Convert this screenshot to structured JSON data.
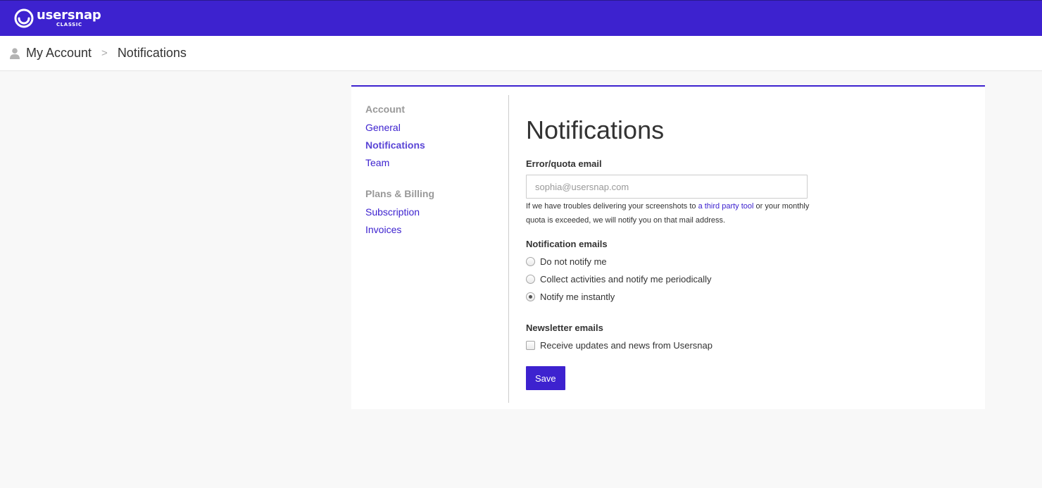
{
  "brand": {
    "name": "usersnap",
    "edition": "CLASSIC",
    "color": "#3d22cf"
  },
  "breadcrumb": {
    "icon": "user-icon",
    "account": "My Account",
    "separator": ">",
    "current": "Notifications"
  },
  "sidebar": {
    "groups": [
      {
        "title": "Account",
        "items": [
          {
            "label": "General",
            "active": false
          },
          {
            "label": "Notifications",
            "active": true
          },
          {
            "label": "Team",
            "active": false
          }
        ]
      },
      {
        "title": "Plans & Billing",
        "items": [
          {
            "label": "Subscription",
            "active": false
          },
          {
            "label": "Invoices",
            "active": false
          }
        ]
      }
    ]
  },
  "main": {
    "title": "Notifications",
    "error_email": {
      "label": "Error/quota email",
      "value": "",
      "placeholder": "sophia@usersnap.com",
      "help_before": "If we have troubles delivering your screenshots to ",
      "help_link": "a third party tool",
      "help_after": " or your monthly quota is exceeded, we will notify you on that mail address."
    },
    "notification_emails": {
      "label": "Notification emails",
      "options": [
        {
          "label": "Do not notify me",
          "checked": false
        },
        {
          "label": "Collect activities and notify me periodically",
          "checked": false
        },
        {
          "label": "Notify me instantly",
          "checked": true
        }
      ]
    },
    "newsletter": {
      "label": "Newsletter emails",
      "checkbox_label": "Receive updates and news from Usersnap",
      "checked": false
    },
    "save_label": "Save"
  }
}
